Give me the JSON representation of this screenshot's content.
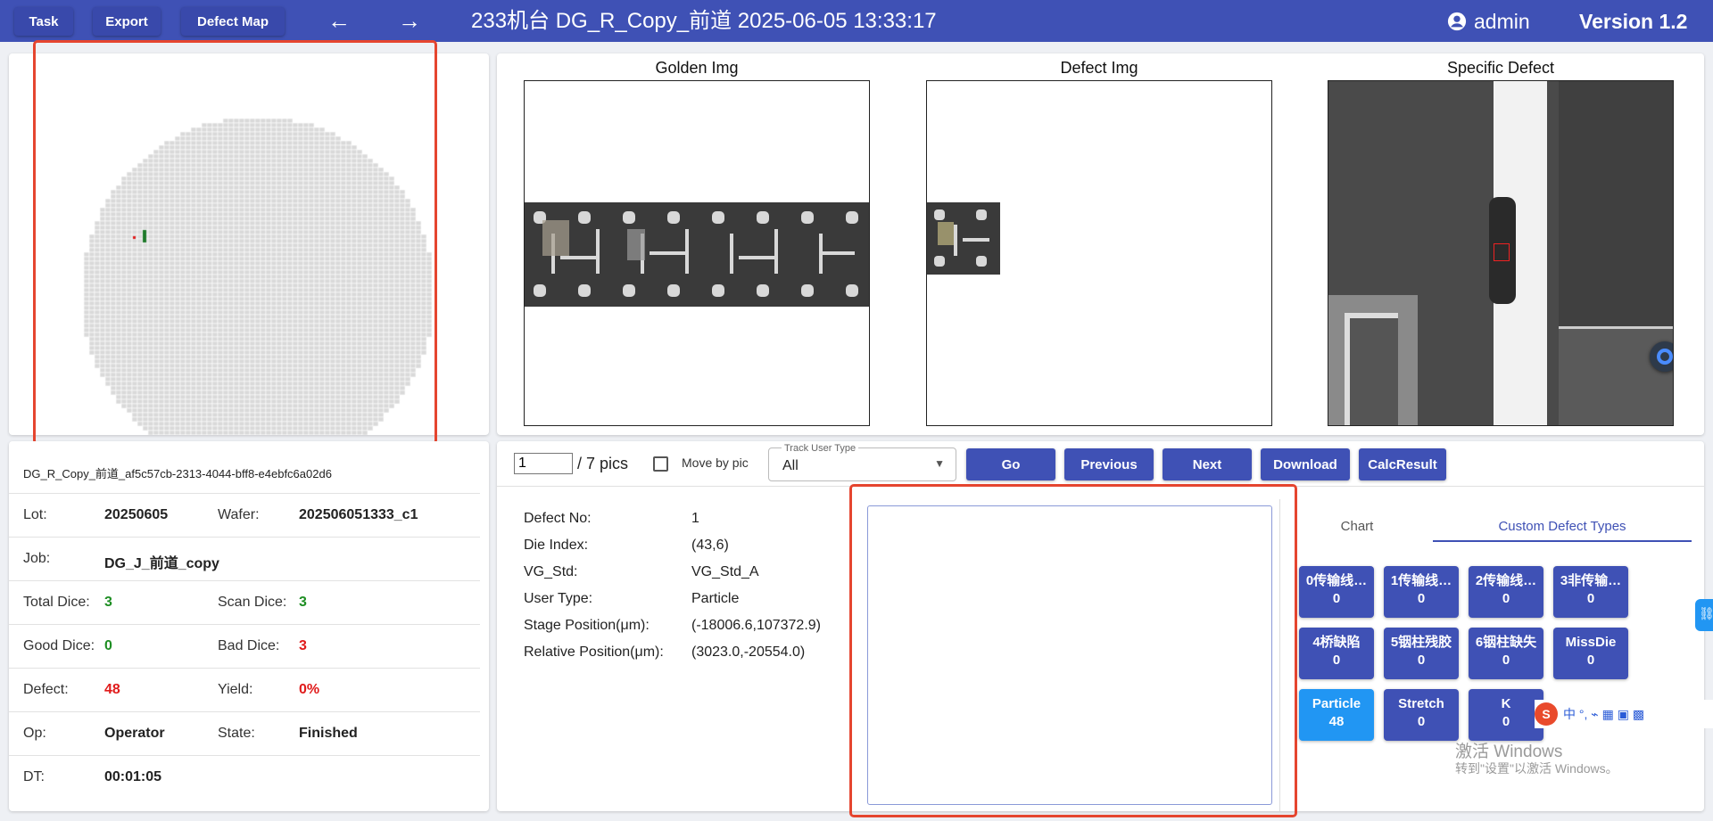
{
  "toolbar": {
    "task_label": "Task",
    "export_label": "Export",
    "defect_map_label": "Defect Map",
    "title": "233机台   DG_R_Copy_前道   2025-06-05 13:33:17",
    "user": "admin",
    "version": "Version 1.2"
  },
  "images": {
    "golden_title": "Golden Img",
    "defect_title": "Defect Img",
    "specific_title": "Specific Defect"
  },
  "info": {
    "id": "DG_R_Copy_前道_af5c57cb-2313-4044-bff8-e4ebfc6a02d6",
    "rows": [
      {
        "l1": "Lot:",
        "v1": "20250605",
        "l2": "Wafer:",
        "v2": "202506051333_c1"
      },
      {
        "l1": "Job:",
        "v1": "DG_J_前道_copy",
        "l2": "",
        "v2": ""
      },
      {
        "l1": "Total Dice:",
        "v1": "3",
        "l2": "Scan Dice:",
        "v2": "3"
      },
      {
        "l1": "Good Dice:",
        "v1": "0",
        "l2": "Bad Dice:",
        "v2": "3"
      },
      {
        "l1": "Defect:",
        "v1": "48",
        "l2": "Yield:",
        "v2": "0%"
      },
      {
        "l1": "Op:",
        "v1": "Operator",
        "l2": "State:",
        "v2": "Finished"
      },
      {
        "l1": "DT:",
        "v1": "00:01:05",
        "l2": "",
        "v2": ""
      }
    ]
  },
  "controls": {
    "pic_value": "1",
    "pic_total": "/ 7 pics",
    "move_by_pic": "Move by pic",
    "track_label": "Track User Type",
    "track_value": "All",
    "go": "Go",
    "previous": "Previous",
    "next": "Next",
    "download": "Download",
    "calc": "CalcResult"
  },
  "defect": {
    "labels": [
      "Defect No:",
      "Die Index:",
      "VG_Std:",
      "User Type:",
      "Stage Position(μm):",
      "Relative Position(μm):"
    ],
    "values": [
      "1",
      "(43,6)",
      "VG_Std_A",
      "Particle",
      "(-18006.6,107372.9)",
      "(3023.0,-20554.0)"
    ]
  },
  "tabs": {
    "chart": "Chart",
    "custom": "Custom Defect Types"
  },
  "defect_types": [
    {
      "name": "0传输线…",
      "count": "0"
    },
    {
      "name": "1传输线…",
      "count": "0"
    },
    {
      "name": "2传输线…",
      "count": "0"
    },
    {
      "name": "3非传输…",
      "count": "0"
    },
    {
      "name": "4桥缺陷",
      "count": "0"
    },
    {
      "name": "5铟柱残胶",
      "count": "0"
    },
    {
      "name": "6铟柱缺失",
      "count": "0"
    },
    {
      "name": "MissDie",
      "count": "0"
    },
    {
      "name": "Particle",
      "count": "48"
    },
    {
      "name": "Stretch",
      "count": "0"
    },
    {
      "name": "K",
      "count": "0"
    }
  ],
  "watermark": {
    "line1": "激活 Windows",
    "line2": "转到\"设置\"以激活 Windows。"
  },
  "colors": {
    "primary": "#3f51b5",
    "active": "#2196f3",
    "highlight": "#e5452f",
    "good": "#1e8e23",
    "bad": "#e01b1b"
  }
}
